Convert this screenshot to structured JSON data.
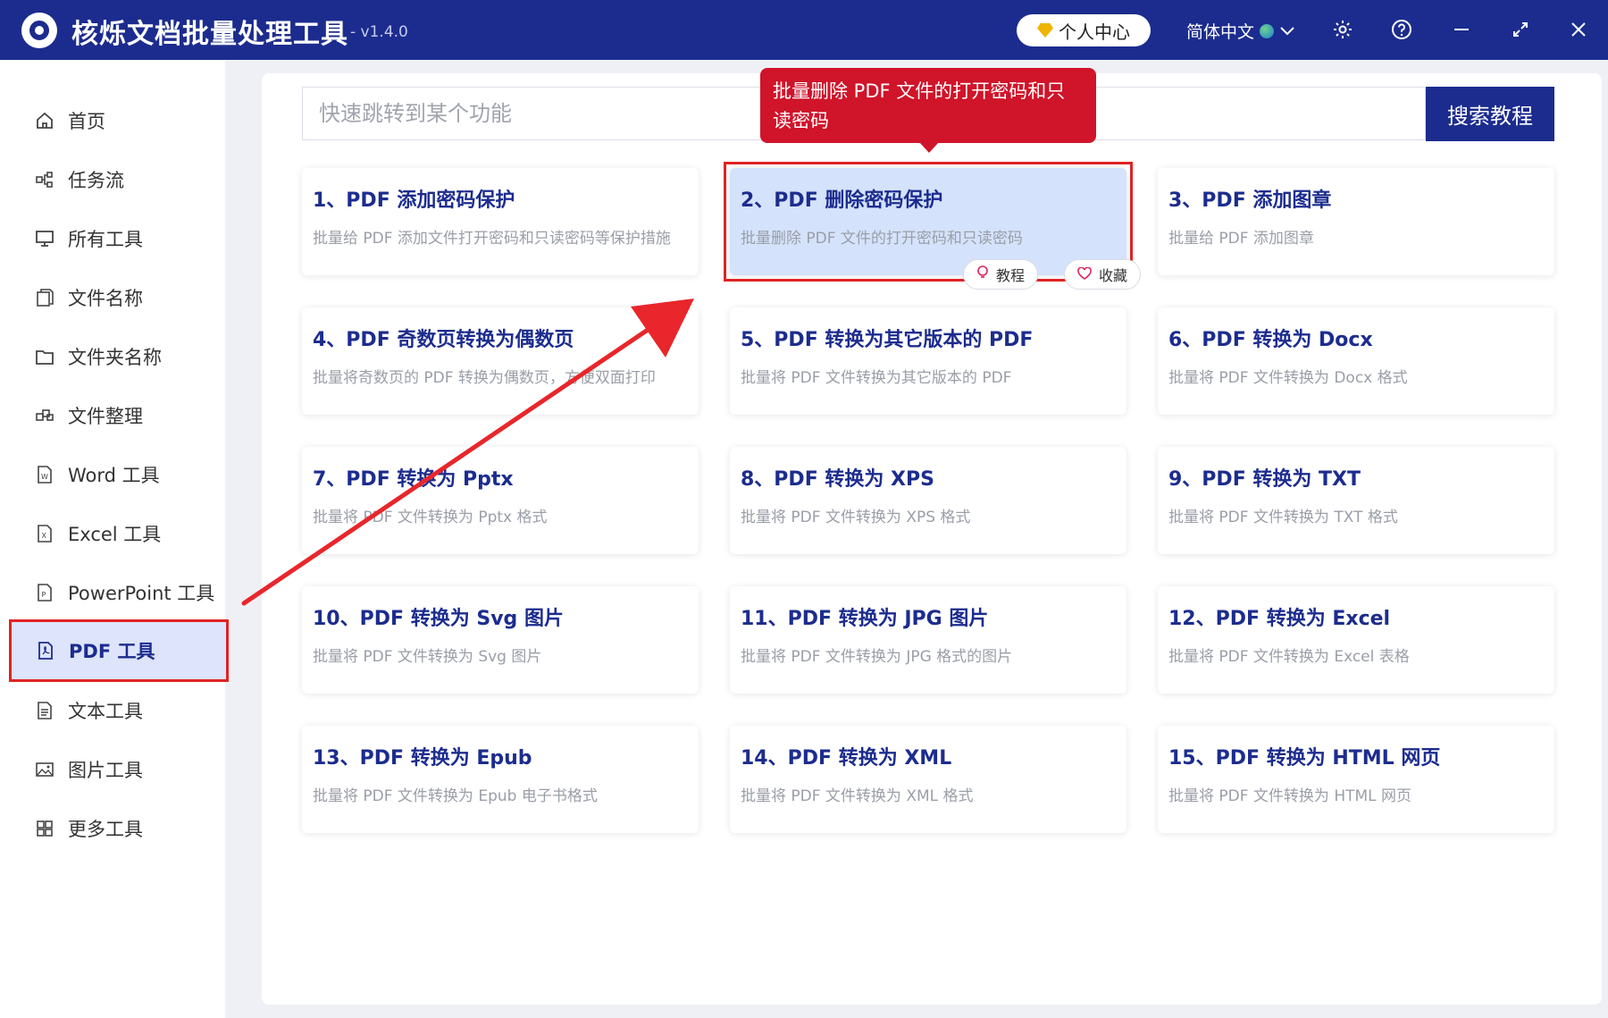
{
  "app": {
    "title": "核烁文档批量处理工具",
    "version": "- v1.4.0",
    "user_center": "个人中心",
    "language": "简体中文"
  },
  "colors": {
    "brand": "#1c2c8e",
    "highlight": "#e02323",
    "tooltip": "#d0142a",
    "active_bg": "#dde4fb"
  },
  "sidebar": {
    "items": [
      {
        "label": "首页",
        "icon": "home-icon"
      },
      {
        "label": "任务流",
        "icon": "workflow-icon"
      },
      {
        "label": "所有工具",
        "icon": "monitor-icon"
      },
      {
        "label": "文件名称",
        "icon": "file-copy-icon"
      },
      {
        "label": "文件夹名称",
        "icon": "folder-icon"
      },
      {
        "label": "文件整理",
        "icon": "organize-icon"
      },
      {
        "label": "Word 工具",
        "icon": "word-file-icon"
      },
      {
        "label": "Excel 工具",
        "icon": "excel-file-icon"
      },
      {
        "label": "PowerPoint 工具",
        "icon": "ppt-file-icon"
      },
      {
        "label": "PDF 工具",
        "icon": "pdf-file-icon"
      },
      {
        "label": "文本工具",
        "icon": "text-file-icon"
      },
      {
        "label": "图片工具",
        "icon": "image-icon"
      },
      {
        "label": "更多工具",
        "icon": "grid-icon"
      }
    ],
    "active": "PDF 工具"
  },
  "search": {
    "placeholder": "快速跳转到某个功能",
    "button": "搜索教程"
  },
  "tooltip": "批量删除 PDF 文件的打开密码和只读密码",
  "card_actions": {
    "tutorial": "教程",
    "favorite": "收藏"
  },
  "cards": [
    {
      "title": "1、PDF 添加密码保护",
      "desc": "批量给 PDF 添加文件打开密码和只读密码等保护措施"
    },
    {
      "title": "2、PDF 删除密码保护",
      "desc": "批量删除 PDF 文件的打开密码和只读密码"
    },
    {
      "title": "3、PDF 添加图章",
      "desc": "批量给 PDF 添加图章"
    },
    {
      "title": "4、PDF 奇数页转换为偶数页",
      "desc": "批量将奇数页的 PDF 转换为偶数页，方便双面打印"
    },
    {
      "title": "5、PDF 转换为其它版本的 PDF",
      "desc": "批量将 PDF 文件转换为其它版本的 PDF"
    },
    {
      "title": "6、PDF 转换为 Docx",
      "desc": "批量将 PDF 文件转换为 Docx 格式"
    },
    {
      "title": "7、PDF 转换为 Pptx",
      "desc": "批量将 PDF 文件转换为 Pptx 格式"
    },
    {
      "title": "8、PDF 转换为 XPS",
      "desc": "批量将 PDF 文件转换为 XPS 格式"
    },
    {
      "title": "9、PDF 转换为 TXT",
      "desc": "批量将 PDF 文件转换为 TXT 格式"
    },
    {
      "title": "10、PDF 转换为 Svg 图片",
      "desc": "批量将 PDF 文件转换为 Svg 图片"
    },
    {
      "title": "11、PDF 转换为 JPG 图片",
      "desc": "批量将 PDF 文件转换为 JPG 格式的图片"
    },
    {
      "title": "12、PDF 转换为 Excel",
      "desc": "批量将 PDF 文件转换为 Excel 表格"
    },
    {
      "title": "13、PDF 转换为 Epub",
      "desc": "批量将 PDF 文件转换为 Epub 电子书格式"
    },
    {
      "title": "14、PDF 转换为 XML",
      "desc": "批量将 PDF 文件转换为 XML 格式"
    },
    {
      "title": "15、PDF 转换为 HTML 网页",
      "desc": "批量将 PDF 文件转换为 HTML 网页"
    }
  ]
}
